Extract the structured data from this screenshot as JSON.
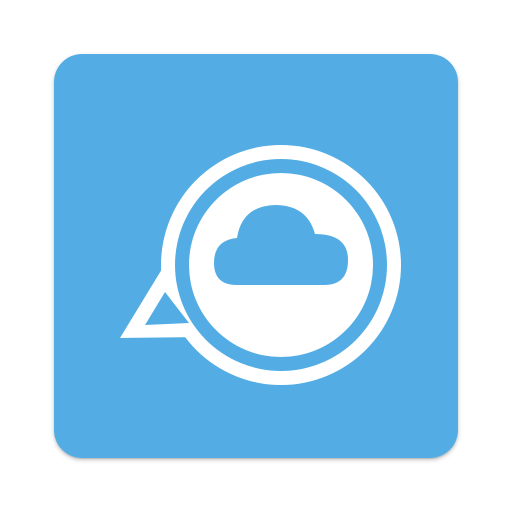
{
  "app_icon": {
    "icon_name": "chat-bubble-cloud-icon",
    "colors": {
      "background": "#53ADE4",
      "foreground": "#FFFFFF"
    }
  }
}
